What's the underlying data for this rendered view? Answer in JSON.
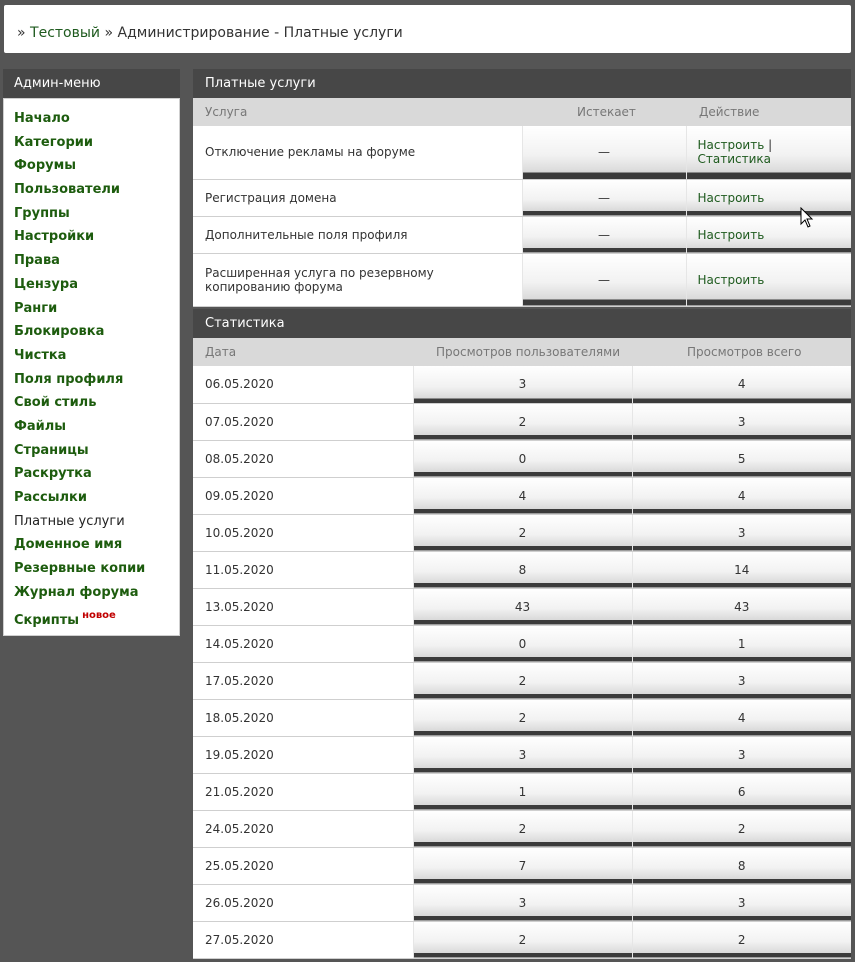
{
  "breadcrumb": {
    "prefix": "»",
    "site": "Тестовый",
    "separator": "»",
    "current": "Администрирование - Платные услуги"
  },
  "sidebar": {
    "title": "Админ-меню",
    "items": [
      {
        "label": "Начало"
      },
      {
        "label": "Категории"
      },
      {
        "label": "Форумы"
      },
      {
        "label": "Пользователи"
      },
      {
        "label": "Группы"
      },
      {
        "label": "Настройки"
      },
      {
        "label": "Права"
      },
      {
        "label": "Цензура"
      },
      {
        "label": "Ранги"
      },
      {
        "label": "Блокировка"
      },
      {
        "label": "Чистка"
      },
      {
        "label": "Поля профиля"
      },
      {
        "label": "Свой стиль"
      },
      {
        "label": "Файлы"
      },
      {
        "label": "Страницы"
      },
      {
        "label": "Раскрутка"
      },
      {
        "label": "Рассылки"
      },
      {
        "label": "Платные услуги",
        "active": true
      },
      {
        "label": "Доменное имя"
      },
      {
        "label": "Резервные копии"
      },
      {
        "label": "Журнал форума"
      },
      {
        "label": "Скрипты",
        "badge": "новое"
      }
    ]
  },
  "services": {
    "title": "Платные услуги",
    "columns": [
      "Услуга",
      "Истекает",
      "Действие"
    ],
    "rows": [
      {
        "name": "Отключение рекламы на форуме",
        "expires": "—",
        "action": "Настроить",
        "action2": "Статистика",
        "sep": "|"
      },
      {
        "name": "Регистрация домена",
        "expires": "—",
        "action": "Настроить"
      },
      {
        "name": "Дополнительные поля профиля",
        "expires": "—",
        "action": "Настроить"
      },
      {
        "name": "Расширенная услуга по резервному копированию форума",
        "expires": "—",
        "action": "Настроить"
      }
    ]
  },
  "stats": {
    "title": "Статистика",
    "columns": [
      "Дата",
      "Просмотров пользователями",
      "Просмотров всего"
    ],
    "rows": [
      {
        "date": "06.05.2020",
        "users": "3",
        "total": "4"
      },
      {
        "date": "07.05.2020",
        "users": "2",
        "total": "3"
      },
      {
        "date": "08.05.2020",
        "users": "0",
        "total": "5"
      },
      {
        "date": "09.05.2020",
        "users": "4",
        "total": "4"
      },
      {
        "date": "10.05.2020",
        "users": "2",
        "total": "3"
      },
      {
        "date": "11.05.2020",
        "users": "8",
        "total": "14"
      },
      {
        "date": "13.05.2020",
        "users": "43",
        "total": "43"
      },
      {
        "date": "14.05.2020",
        "users": "0",
        "total": "1"
      },
      {
        "date": "17.05.2020",
        "users": "2",
        "total": "3"
      },
      {
        "date": "18.05.2020",
        "users": "2",
        "total": "4"
      },
      {
        "date": "19.05.2020",
        "users": "3",
        "total": "3"
      },
      {
        "date": "21.05.2020",
        "users": "1",
        "total": "6"
      },
      {
        "date": "24.05.2020",
        "users": "2",
        "total": "2"
      },
      {
        "date": "25.05.2020",
        "users": "7",
        "total": "8"
      },
      {
        "date": "26.05.2020",
        "users": "3",
        "total": "3"
      },
      {
        "date": "27.05.2020",
        "users": "2",
        "total": "2"
      }
    ]
  }
}
